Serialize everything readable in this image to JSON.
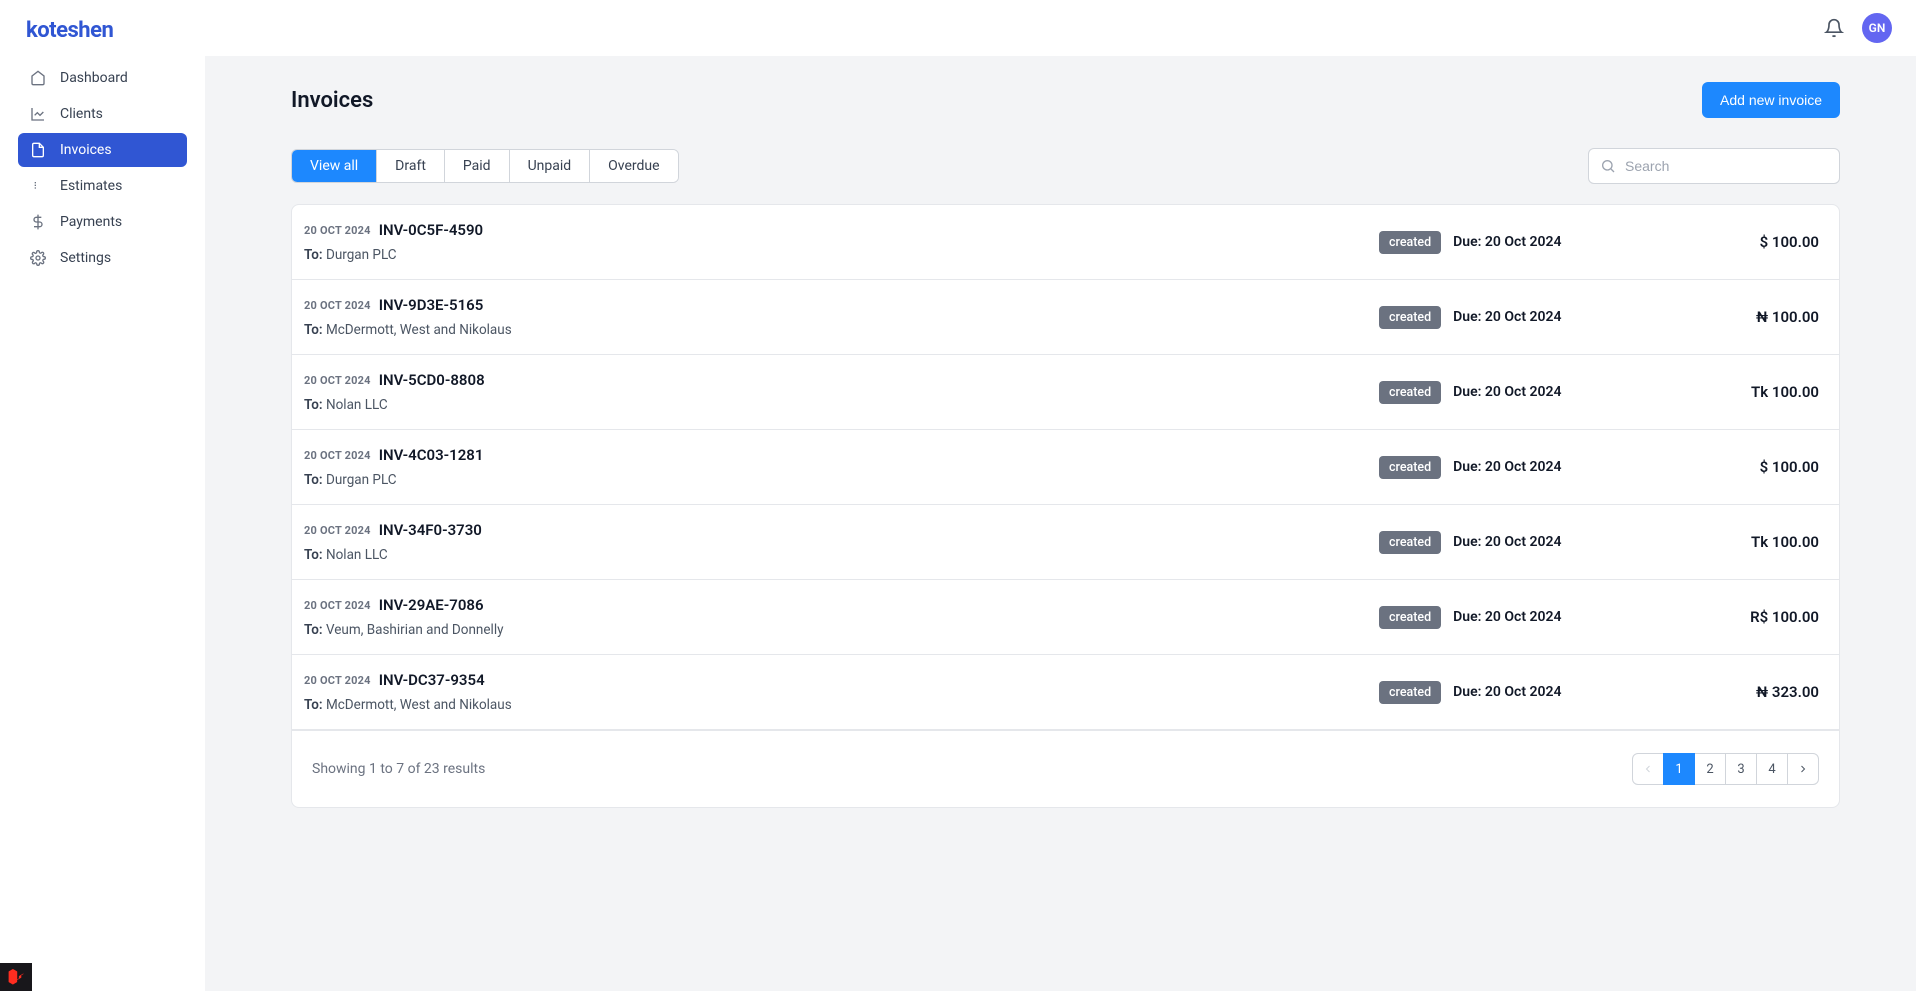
{
  "brand": "koteshen",
  "sidebar": {
    "items": [
      {
        "label": "Dashboard",
        "active": false
      },
      {
        "label": "Clients",
        "active": false
      },
      {
        "label": "Invoices",
        "active": true
      },
      {
        "label": "Estimates",
        "active": false
      },
      {
        "label": "Payments",
        "active": false
      },
      {
        "label": "Settings",
        "active": false
      }
    ]
  },
  "user": {
    "initials": "GN"
  },
  "page": {
    "title": "Invoices",
    "add_button": "Add new invoice"
  },
  "tabs": [
    {
      "label": "View all",
      "active": true
    },
    {
      "label": "Draft",
      "active": false
    },
    {
      "label": "Paid",
      "active": false
    },
    {
      "label": "Unpaid",
      "active": false
    },
    {
      "label": "Overdue",
      "active": false
    }
  ],
  "search": {
    "placeholder": "Search"
  },
  "labels": {
    "to_prefix": "To:",
    "due_prefix": "Due:"
  },
  "invoices": [
    {
      "date": "20 OCT 2024",
      "num": "INV-0C5F-4590",
      "to": "Durgan PLC",
      "status": "created",
      "due": "20 Oct 2024",
      "amount": "$ 100.00"
    },
    {
      "date": "20 OCT 2024",
      "num": "INV-9D3E-5165",
      "to": "McDermott, West and Nikolaus",
      "status": "created",
      "due": "20 Oct 2024",
      "amount": "₦ 100.00"
    },
    {
      "date": "20 OCT 2024",
      "num": "INV-5CD0-8808",
      "to": "Nolan LLC",
      "status": "created",
      "due": "20 Oct 2024",
      "amount": "Tk 100.00"
    },
    {
      "date": "20 OCT 2024",
      "num": "INV-4C03-1281",
      "to": "Durgan PLC",
      "status": "created",
      "due": "20 Oct 2024",
      "amount": "$ 100.00"
    },
    {
      "date": "20 OCT 2024",
      "num": "INV-34F0-3730",
      "to": "Nolan LLC",
      "status": "created",
      "due": "20 Oct 2024",
      "amount": "Tk 100.00"
    },
    {
      "date": "20 OCT 2024",
      "num": "INV-29AE-7086",
      "to": "Veum, Bashirian and Donnelly",
      "status": "created",
      "due": "20 Oct 2024",
      "amount": "R$ 100.00"
    },
    {
      "date": "20 OCT 2024",
      "num": "INV-DC37-9354",
      "to": "McDermott, West and Nikolaus",
      "status": "created",
      "due": "20 Oct 2024",
      "amount": "₦ 323.00"
    }
  ],
  "footer": {
    "results_text": "Showing 1 to 7 of 23 results",
    "pages": [
      "1",
      "2",
      "3",
      "4"
    ],
    "current_page": "1"
  }
}
